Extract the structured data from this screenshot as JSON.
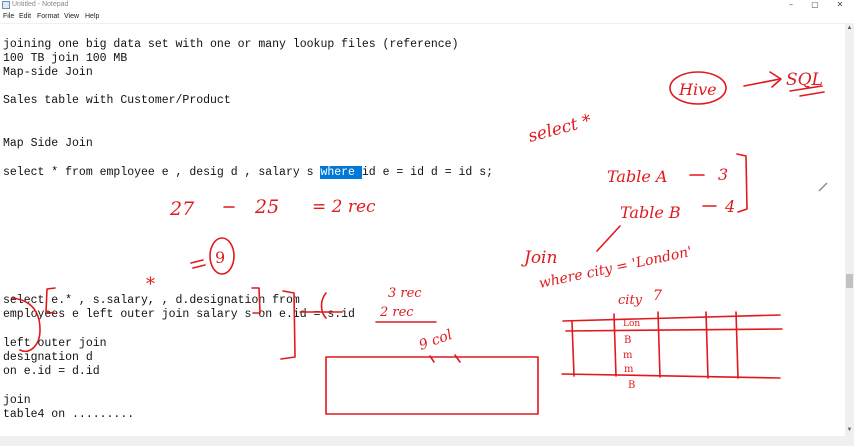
{
  "window": {
    "title": "Untitled - Notepad",
    "minimize_glyph": "–",
    "maximize_glyph": "▢",
    "close_glyph": "✕"
  },
  "menu": [
    "File",
    "Edit",
    "Format",
    "View",
    "Help"
  ],
  "editor": {
    "lines": [
      "joining one big data set with one or many lookup files (reference)",
      "100 TB join 100 MB",
      "Map-side Join",
      "",
      "Sales table with Customer/Product",
      "",
      "",
      "Map Side Join",
      "",
      "select * from employee e , desig d , salary s ",
      "",
      "",
      "",
      "",
      "",
      "",
      "",
      "",
      "select e.* , s.salary, , d.designation from",
      "employees e left outer join salary s on e.id = s.id",
      "",
      "left outer join",
      "designation d",
      "on e.id = d.id",
      "",
      "join",
      "table4 on ........."
    ],
    "select_line_selected": "where ",
    "select_line_rest": "id e = id d = id s;"
  },
  "annotations": {
    "hive": "Hive",
    "sql": "SQL",
    "select_star": "select *",
    "table_a": "Table A",
    "table_a_count": "3",
    "table_b": "Table B",
    "table_b_count": "4",
    "join": "Join",
    "where_city": "where city = 'London'",
    "calc_a": "27",
    "calc_b": "25",
    "calc_c": "= 2 rec",
    "nine": "9",
    "star": "*",
    "three_rec": "3 rec",
    "two_rec": "2 rec",
    "nine_col": "9 col",
    "city": "city",
    "seven": "7",
    "col_values": [
      "Lon",
      "B",
      "m",
      "m",
      "B"
    ]
  }
}
